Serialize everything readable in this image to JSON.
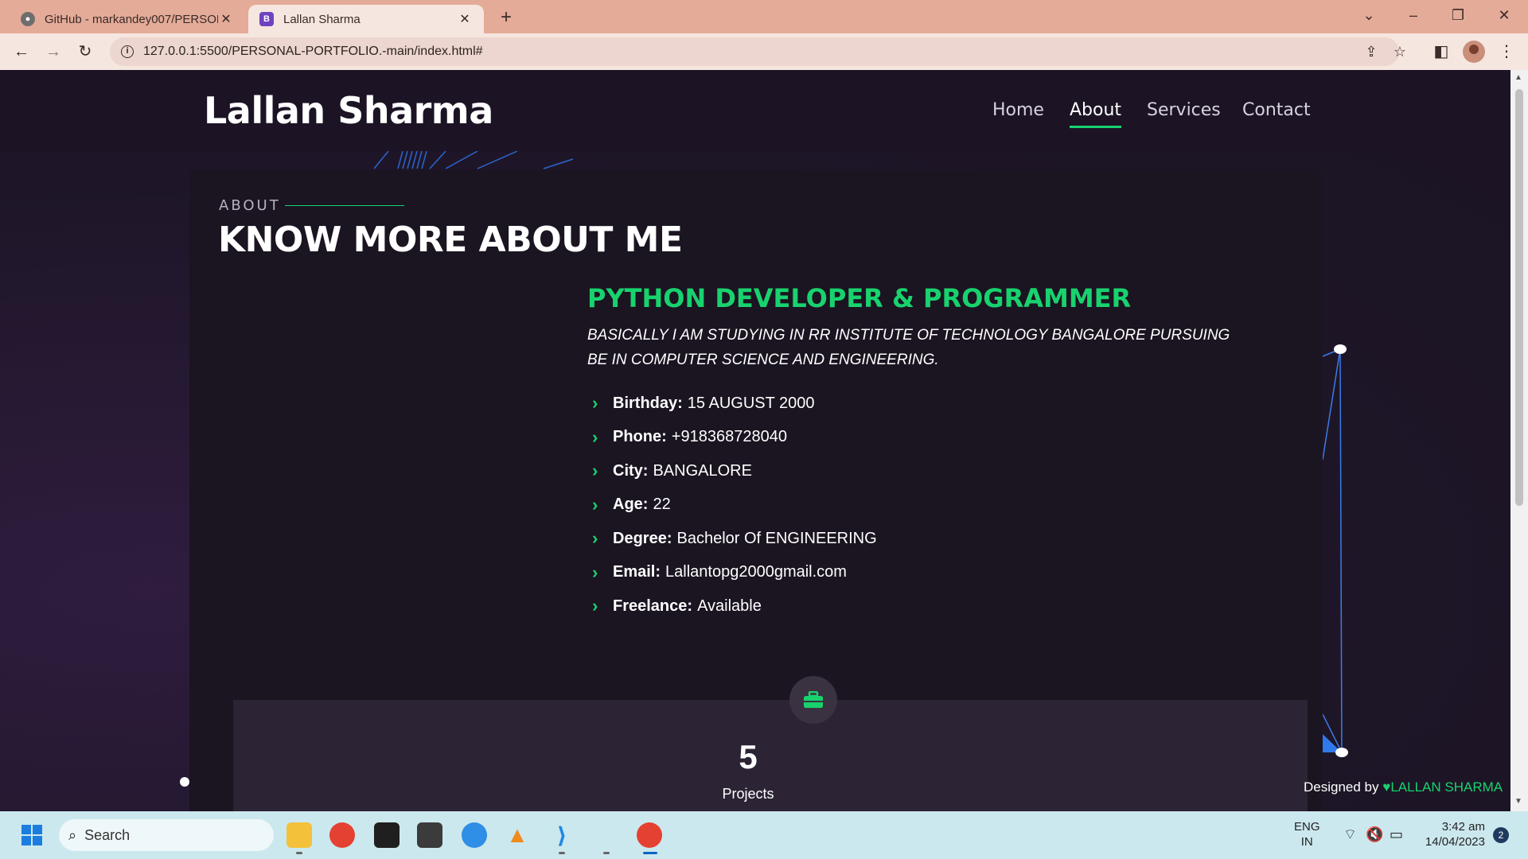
{
  "browser": {
    "tabs": [
      {
        "title": "GitHub - markandey007/PERSON",
        "active": false
      },
      {
        "title": "Lallan Sharma",
        "active": true
      }
    ],
    "favicon_letter": "B",
    "url": "127.0.0.1:5500/PERSONAL-PORTFOLIO.-main/index.html#",
    "icons": {
      "back": "arrow-left-icon",
      "forward": "arrow-right-icon",
      "reload": "reload-icon",
      "share": "share-icon",
      "bookmark": "star-icon",
      "sidebar": "side-panel-icon",
      "profile": "avatar-icon",
      "menu": "kebab-menu-icon"
    }
  },
  "site": {
    "logo": "Lallan Sharma",
    "nav": [
      "Home",
      "About",
      "Services",
      "Contact"
    ],
    "active_nav": "About",
    "accent_color": "#18d26e"
  },
  "about": {
    "eyebrow": "ABOUT",
    "heading": "KNOW MORE ABOUT ME",
    "subtitle": "PYTHON DEVELOPER & PROGRAMMER",
    "description": "BASICALLY I AM STUDYING IN RR INSTITUTE OF TECHNOLOGY BANGALORE PURSUING BE IN COMPUTER SCIENCE AND ENGINEERING.",
    "facts": [
      {
        "key": "Birthday:",
        "value": "15 AUGUST 2000"
      },
      {
        "key": "Phone:",
        "value": "+918368728040"
      },
      {
        "key": "City:",
        "value": "BANGALORE"
      },
      {
        "key": "Age:",
        "value": "22"
      },
      {
        "key": "Degree:",
        "value": "Bachelor Of ENGINEERING"
      },
      {
        "key": "Email:",
        "value": "Lallantopg2000gmail.com"
      },
      {
        "key": "Freelance:",
        "value": "Available"
      }
    ]
  },
  "counter": {
    "number": "5",
    "label": "Projects",
    "icon": "briefcase-icon"
  },
  "footer": {
    "prefix": "Designed by ",
    "name": "LALLAN SHARMA"
  },
  "taskbar": {
    "search_placeholder": "Search",
    "language": "ENG",
    "region": "IN",
    "time": "3:42 am",
    "date": "14/04/2023",
    "notifications": "2"
  }
}
